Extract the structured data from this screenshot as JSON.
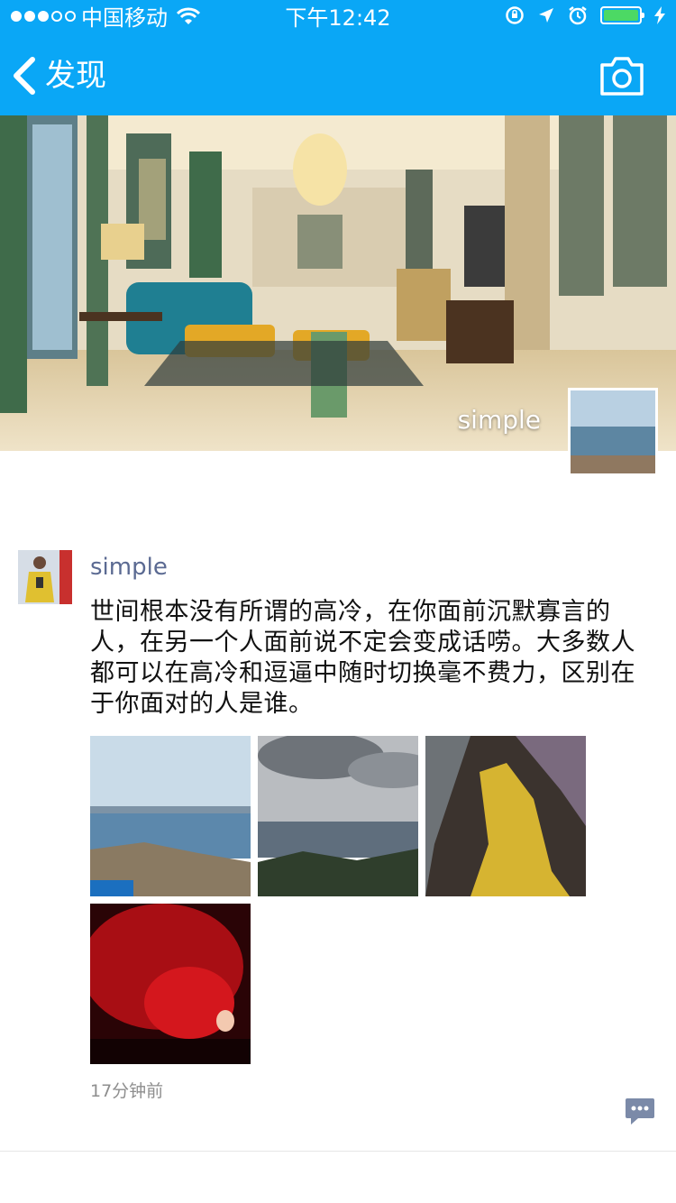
{
  "status_bar": {
    "carrier": "中国移动",
    "time": "下午12:42",
    "battery_color": "#4cd964"
  },
  "nav": {
    "back_label": "发现",
    "back_icon": "chevron-left-icon",
    "camera_icon": "camera-icon",
    "bar_color": "#0aa7f6"
  },
  "cover": {
    "username": "simple"
  },
  "post": {
    "username": "simple",
    "text": "世间根本没有所谓的高冷，在你面前沉默寡言的人，在另一个人面前说不定会变成话唠。大多数人都可以在高冷和逗逼中随时切换毫不费力，区别在于你面对的人是谁。",
    "time": "17分钟前",
    "comment_icon": "comment-bubble-icon",
    "photos": [
      {
        "subject": "sea-coast"
      },
      {
        "subject": "city-from-mountain"
      },
      {
        "subject": "cave-stalactites"
      },
      {
        "subject": "red-cave"
      }
    ]
  }
}
